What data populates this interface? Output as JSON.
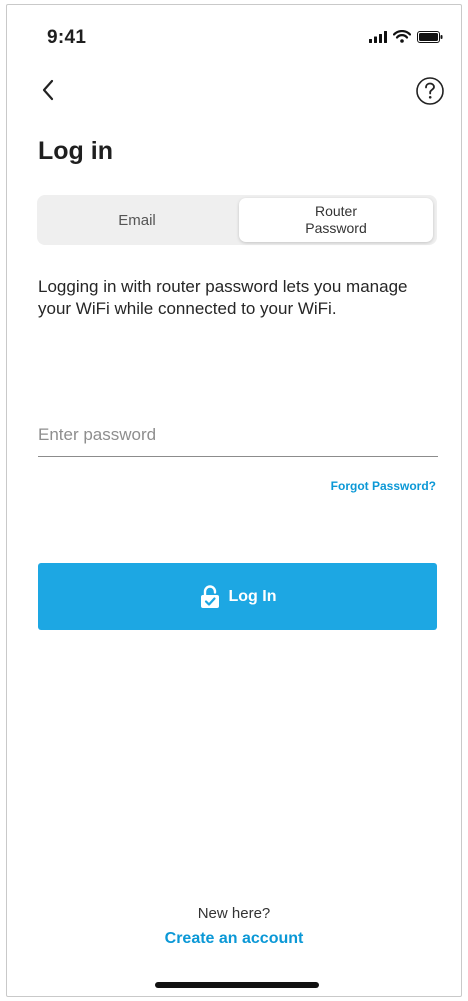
{
  "status_bar": {
    "time": "9:41",
    "icons": [
      "signal-icon",
      "wifi-icon",
      "battery-icon"
    ]
  },
  "nav": {
    "back_icon": "chevron-left-icon",
    "help_icon": "question-circle-icon"
  },
  "page": {
    "title": "Log in"
  },
  "tabs": {
    "items": [
      {
        "label": "Email",
        "selected": false
      },
      {
        "label_line1": "Router",
        "label_line2": "Password",
        "selected": true
      }
    ]
  },
  "description": "Logging in with router password lets you manage your WiFi while connected to your WiFi.",
  "password_field": {
    "value": "",
    "placeholder": "Enter password"
  },
  "forgot_password": "Forgot Password?",
  "login_button": {
    "label": "Log In",
    "icon": "unlock-icon"
  },
  "footer": {
    "prompt": "New here?",
    "link": "Create an account"
  },
  "colors": {
    "accent": "#1da7e3",
    "link": "#0b98d6",
    "text": "#1f1f1f",
    "segment_bg": "#efefef"
  }
}
